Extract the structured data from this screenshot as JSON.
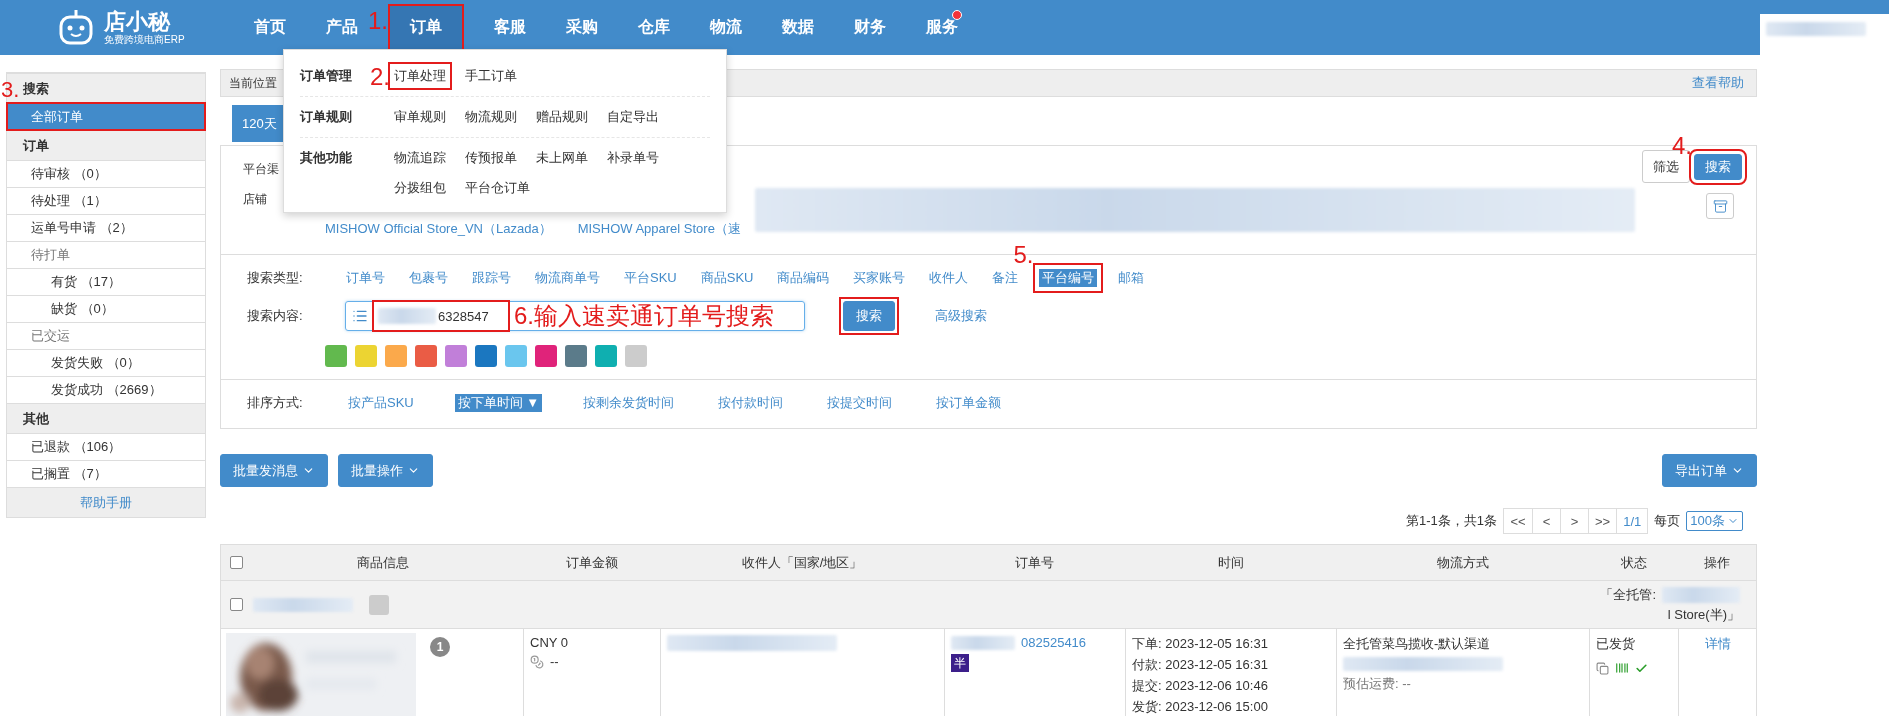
{
  "header": {
    "brand": "店小秘",
    "tagline": "免费跨境电商ERP",
    "nav": [
      {
        "label": "首页",
        "selected": false,
        "dot": false
      },
      {
        "label": "产品",
        "selected": false,
        "dot": false
      },
      {
        "label": "订单",
        "selected": true,
        "dot": false,
        "annotation": "1."
      },
      {
        "label": "客服",
        "selected": false,
        "dot": false
      },
      {
        "label": "采购",
        "selected": false,
        "dot": false
      },
      {
        "label": "仓库",
        "selected": false,
        "dot": false
      },
      {
        "label": "物流",
        "selected": false,
        "dot": false
      },
      {
        "label": "数据",
        "selected": false,
        "dot": false
      },
      {
        "label": "财务",
        "selected": false,
        "dot": false
      },
      {
        "label": "服务",
        "selected": false,
        "dot": true
      }
    ]
  },
  "nav_menu": {
    "groups": [
      {
        "title": "订单管理",
        "links": [
          {
            "label": "订单处理",
            "annotation": "2."
          },
          {
            "label": "手工订单"
          }
        ]
      },
      {
        "title": "订单规则",
        "links": [
          {
            "label": "审单规则"
          },
          {
            "label": "物流规则"
          },
          {
            "label": "赠品规则"
          },
          {
            "label": "自定导出"
          }
        ]
      },
      {
        "title": "其他功能",
        "links": [
          {
            "label": "物流追踪"
          },
          {
            "label": "传预报单"
          },
          {
            "label": "未上网单"
          },
          {
            "label": "补录单号"
          },
          {
            "label": "分拨组包"
          },
          {
            "label": "平台仓订单"
          }
        ]
      }
    ]
  },
  "sidebar": {
    "sections": [
      {
        "title": "搜索",
        "items": [
          {
            "label": "全部订单",
            "selected": true,
            "annotation": "3."
          }
        ]
      },
      {
        "title": "订单",
        "items": [
          {
            "label": "待审核 （0）",
            "selected": false
          },
          {
            "label": "待处理 （1）",
            "selected": false
          },
          {
            "label": "运单号申请 （2）",
            "selected": false
          },
          {
            "label": "待打单",
            "selected": false,
            "children": [
              {
                "label": "有货 （17）",
                "selected": false
              },
              {
                "label": "缺货 （0）",
                "selected": false
              }
            ]
          },
          {
            "label": "已交运",
            "selected": false,
            "children": [
              {
                "label": "发货失败 （0）",
                "selected": false
              },
              {
                "label": "发货成功 （2669）",
                "selected": false
              }
            ]
          }
        ]
      },
      {
        "title": "其他",
        "items": [
          {
            "label": "已退款 （106）",
            "selected": false
          },
          {
            "label": "已搁置 （7）",
            "selected": false
          }
        ]
      }
    ],
    "footer": "帮助手册"
  },
  "breadcrumb": {
    "label": "当前位置",
    "help": "查看帮助"
  },
  "tabs": [
    {
      "label": "120天",
      "selected": true
    }
  ],
  "filter": {
    "platform_label": "平台渠",
    "store_label": "店铺",
    "stores": [
      "MISHOW Official Store_VN（Lazada）",
      "MISHOW Apparel Store（速"
    ],
    "buttons": [
      {
        "label": "筛选",
        "primary": false
      },
      {
        "label": "搜索",
        "primary": true,
        "annotation": "4."
      }
    ]
  },
  "search": {
    "type_label": "搜索类型:",
    "types": [
      {
        "label": "订单号",
        "selected": false
      },
      {
        "label": "包裹号",
        "selected": false
      },
      {
        "label": "跟踪号",
        "selected": false
      },
      {
        "label": "物流商单号",
        "selected": false
      },
      {
        "label": "平台SKU",
        "selected": false
      },
      {
        "label": "商品SKU",
        "selected": false
      },
      {
        "label": "商品编码",
        "selected": false
      },
      {
        "label": "买家账号",
        "selected": false
      },
      {
        "label": "收件人",
        "selected": false
      },
      {
        "label": "备注",
        "selected": false
      },
      {
        "label": "平台编号",
        "selected": true,
        "annotation": "5."
      },
      {
        "label": "邮箱",
        "selected": false
      }
    ],
    "content_label": "搜索内容:",
    "value": "6328547",
    "annotation": "6.输入速卖通订单号搜索",
    "button": {
      "label": "搜索",
      "boxed": true
    },
    "advanced": "高级搜索",
    "colors": [
      {
        "color": "#62b94e"
      },
      {
        "color": "#ecd432"
      },
      {
        "color": "#fba94b"
      },
      {
        "color": "#ea5c45"
      },
      {
        "color": "#c17fd9"
      },
      {
        "color": "#1b77c0"
      },
      {
        "color": "#6ac6ee"
      },
      {
        "color": "#e0237a"
      },
      {
        "color": "#5b7b8a"
      },
      {
        "color": "#0fafb0"
      },
      {
        "color": "#cccccc"
      }
    ]
  },
  "sort": {
    "label": "排序方式:",
    "options": [
      {
        "label": "按产品SKU",
        "selected": false
      },
      {
        "label": "按下单时间 ▼",
        "selected": true
      },
      {
        "label": "按剩余发货时间",
        "selected": false
      },
      {
        "label": "按付款时间",
        "selected": false
      },
      {
        "label": "按提交时间",
        "selected": false
      },
      {
        "label": "按订单金额",
        "selected": false
      }
    ]
  },
  "actions": [
    "批量发消息",
    "批量操作"
  ],
  "export": "导出订单",
  "pagination": {
    "summary": "第1-1条，共1条",
    "pages": [
      "<<",
      "<",
      ">",
      ">>",
      "1/1"
    ],
    "per_page_label": "每页",
    "per_page": "100条"
  },
  "table": {
    "checked": false,
    "columns": [
      "商品信息",
      "订单金额",
      "收件人「国家/地区」",
      "订单号",
      "时间",
      "物流方式",
      "状态",
      "操作"
    ],
    "groups": [
      {
        "checked": false,
        "store_prefix": "「全托管:",
        "store_suffix": "l Store(半)」",
        "orders": [
          {
            "quantity": "1",
            "amount": "CNY 0",
            "amount_note": "--",
            "order_no": "082525416",
            "order_tag": "半",
            "times": [
              "下单: 2023-12-05 16:31",
              "付款: 2023-12-05 16:31",
              "提交: 2023-12-06 10:46",
              "发货: 2023-12-06 15:00"
            ],
            "logistics": "全托管菜鸟揽收-默认渠道",
            "shipping_fee": "预估运费: --",
            "status": "已发货",
            "action": "详情"
          }
        ]
      }
    ]
  }
}
